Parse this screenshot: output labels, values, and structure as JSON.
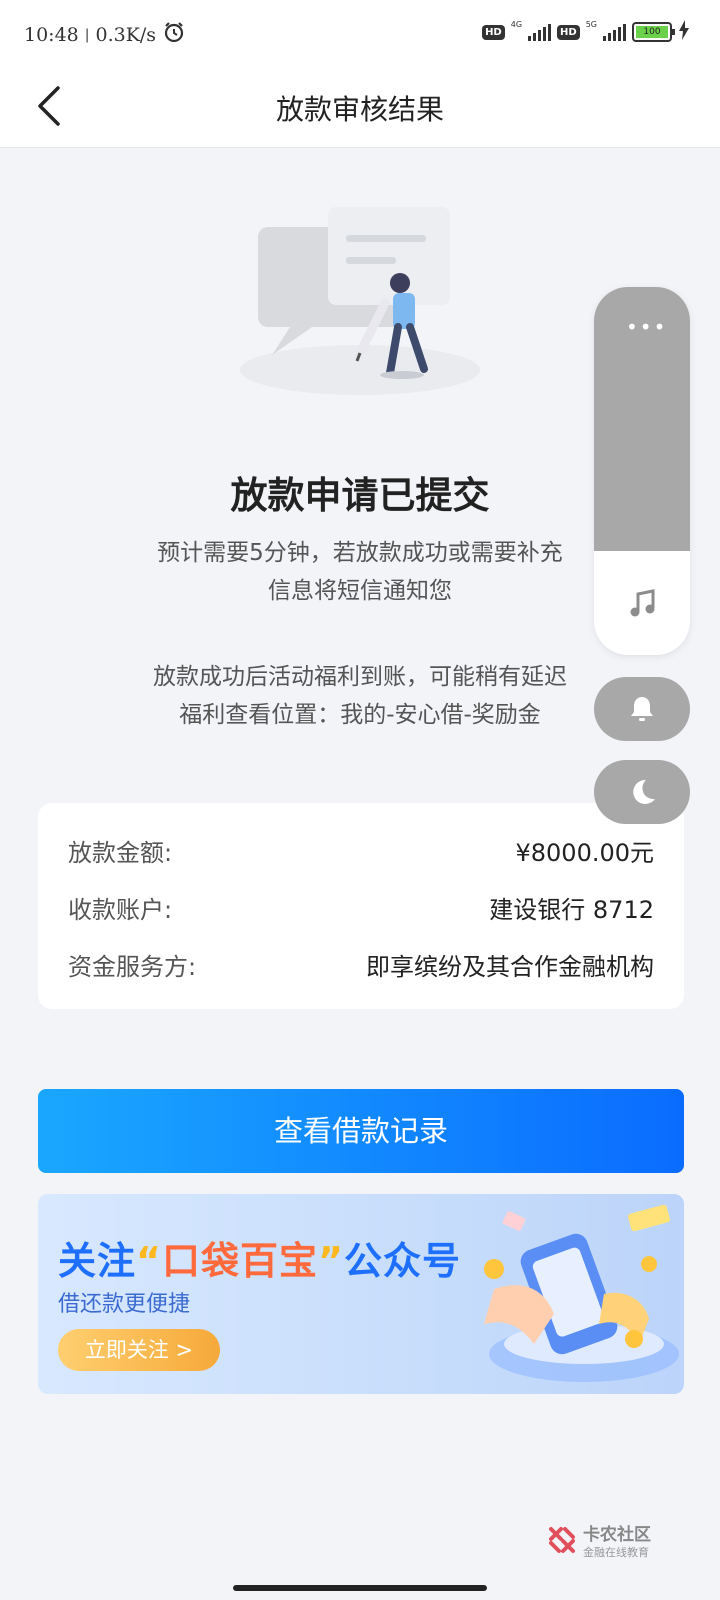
{
  "status_bar": {
    "time": "10:48",
    "separator": "|",
    "speed": "0.3K/s",
    "net1": "4G",
    "net2": "5G",
    "battery": "100",
    "hd": "HD"
  },
  "nav": {
    "title": "放款审核结果"
  },
  "result": {
    "headline": "放款申请已提交",
    "desc_line1": "预计需要5分钟，若放款成功或需要补充",
    "desc_line2": "信息将短信通知您",
    "desc_line3": "放款成功后活动福利到账，可能稍有延迟",
    "desc_line4": "福利查看位置：我的-安心借-奖励金"
  },
  "info": {
    "amount_label": "放款金额:",
    "amount_value": "¥8000.00元",
    "account_label": "收款账户:",
    "account_value": "建设银行 8712",
    "provider_label": "资金服务方:",
    "provider_value": "即享缤纷及其合作金融机构"
  },
  "primary_button": "查看借款记录",
  "banner": {
    "title_pre": "关注",
    "title_quote_open": "“",
    "title_name": "口袋百宝",
    "title_quote_close": "”",
    "title_post": "公众号",
    "subtitle": "借还款更便捷",
    "button": "立即关注 >"
  },
  "floating_panel": {
    "dots": "•••"
  },
  "watermark": {
    "name": "卡农社区",
    "tagline": "金融在线教育"
  },
  "colors": {
    "primary_start": "#1aa7ff",
    "primary_end": "#0a6cff",
    "page_bg": "#f2f4f8"
  }
}
